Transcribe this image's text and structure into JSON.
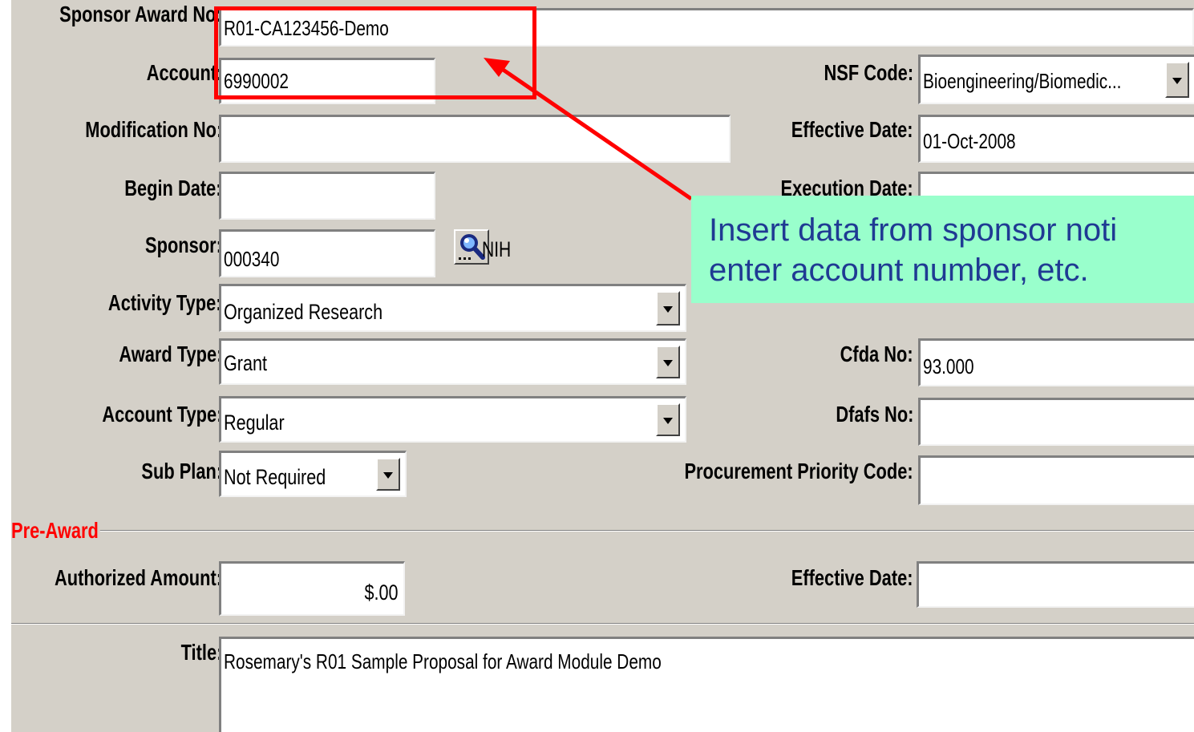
{
  "form": {
    "sponsor_award_no": {
      "label": "Sponsor Award No:",
      "value": "R01-CA123456-Demo"
    },
    "account": {
      "label": "Account:",
      "value": "6990002"
    },
    "nsf_code": {
      "label": "NSF Code:",
      "value": "Bioengineering/Biomedic..."
    },
    "modification_no": {
      "label": "Modification No:",
      "value": ""
    },
    "effective_date": {
      "label": "Effective Date:",
      "value": "01-Oct-2008"
    },
    "begin_date": {
      "label": "Begin Date:",
      "value": ""
    },
    "execution_date": {
      "label": "Execution Date:",
      "value": ""
    },
    "sponsor": {
      "label": "Sponsor:",
      "value": "000340",
      "name": "NIH",
      "icon": "search-lens-icon"
    },
    "activity_type": {
      "label": "Activity Type:",
      "value": "Organized Research"
    },
    "award_type": {
      "label": "Award Type:",
      "value": "Grant"
    },
    "cfda_no": {
      "label": "Cfda No:",
      "value": "93.000"
    },
    "account_type": {
      "label": "Account Type:",
      "value": "Regular"
    },
    "dfafs_no": {
      "label": "Dfafs No:",
      "value": ""
    },
    "sub_plan": {
      "label": "Sub Plan:",
      "value": "Not Required"
    },
    "procurement_priority_code": {
      "label": "Procurement Priority Code:",
      "value": ""
    }
  },
  "pre_award": {
    "section_label": "Pre-Award",
    "authorized_amount": {
      "label": "Authorized Amount:",
      "value": "$.00"
    },
    "effective_date": {
      "label": "Effective Date:",
      "value": ""
    }
  },
  "title": {
    "label": "Title:",
    "value": "Rosemary's R01 Sample Proposal for Award Module Demo"
  },
  "callout": {
    "line1": "Insert data from sponsor noti",
    "line2": "enter account number, etc."
  },
  "colors": {
    "panel": "#d4d0c8",
    "highlight": "#ff0000",
    "callout_bg": "#99ffcc",
    "callout_text": "#1f3a93",
    "section_label": "#ff0000"
  }
}
